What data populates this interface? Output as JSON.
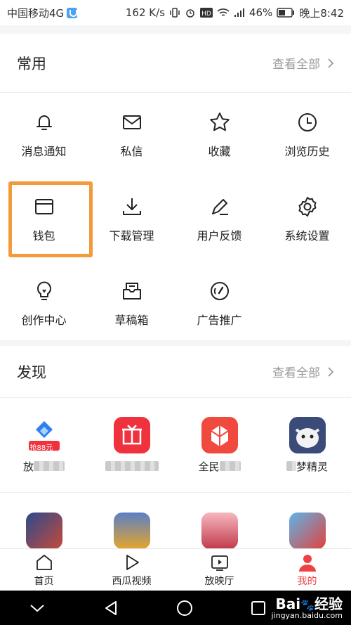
{
  "status_bar": {
    "carrier": "中国移动4G",
    "speed": "162 K/s",
    "battery": "46%",
    "time": "晚上8:42",
    "icons": [
      "vibrate-icon",
      "alarm-icon",
      "hd-icon",
      "wifi-icon",
      "signal-icon",
      "battery-icon"
    ]
  },
  "common": {
    "title": "常用",
    "view_all": "查看全部",
    "items": [
      {
        "label": "消息通知",
        "icon": "bell-icon"
      },
      {
        "label": "私信",
        "icon": "envelope-icon"
      },
      {
        "label": "收藏",
        "icon": "star-icon"
      },
      {
        "label": "浏览历史",
        "icon": "clock-icon"
      },
      {
        "label": "钱包",
        "icon": "wallet-icon"
      },
      {
        "label": "下载管理",
        "icon": "download-icon"
      },
      {
        "label": "用户反馈",
        "icon": "edit-icon"
      },
      {
        "label": "系统设置",
        "icon": "gear-icon"
      },
      {
        "label": "创作中心",
        "icon": "lightbulb-icon"
      },
      {
        "label": "草稿箱",
        "icon": "draft-box-icon"
      },
      {
        "label": "广告推广",
        "icon": "compass-icon"
      }
    ],
    "highlighted": "钱包"
  },
  "discover": {
    "title": "发现",
    "view_all": "查看全部",
    "apps": [
      {
        "label_prefix": "放",
        "label_suffix": "",
        "badge": "抢88元",
        "icon": "blue-heart-app-icon",
        "color": "#2f7ff0"
      },
      {
        "label_prefix": "",
        "label_suffix": "",
        "icon": "red-gift-app-icon",
        "color": "#f0313e"
      },
      {
        "label_prefix": "全民",
        "label_suffix": "",
        "icon": "red-box-app-icon",
        "color": "#f04a3f"
      },
      {
        "label_prefix": "",
        "label_suffix": "梦精灵",
        "icon": "game-creature-app-icon",
        "color": "#3a4b7a"
      },
      {
        "label_prefix": "",
        "label_suffix": "",
        "icon": "game-app-icon-1",
        "color": "#2c4a8c"
      },
      {
        "label_prefix": "",
        "label_suffix": "",
        "icon": "game-app-icon-2",
        "color": "#e7a52c"
      },
      {
        "label_prefix": "",
        "label_suffix": "",
        "icon": "game-app-icon-3",
        "color": "#e6717e"
      },
      {
        "label_prefix": "",
        "label_suffix": "",
        "icon": "game-app-icon-4",
        "color": "#5db4e8"
      }
    ]
  },
  "tab_bar": {
    "tabs": [
      {
        "label": "首页",
        "icon": "home-icon"
      },
      {
        "label": "西瓜视频",
        "icon": "play-icon"
      },
      {
        "label": "放映厅",
        "icon": "tv-icon"
      },
      {
        "label": "我的",
        "icon": "profile-icon"
      }
    ],
    "active": "我的",
    "active_color": "#f04142"
  },
  "nav_bar": {
    "buttons": [
      "chevron-down-icon",
      "back-triangle-icon",
      "home-circle-icon",
      "recents-square-icon"
    ]
  },
  "watermark": {
    "brand": "Bai",
    "brand_tail": "经验",
    "url": "jingyan.baidu.com"
  }
}
